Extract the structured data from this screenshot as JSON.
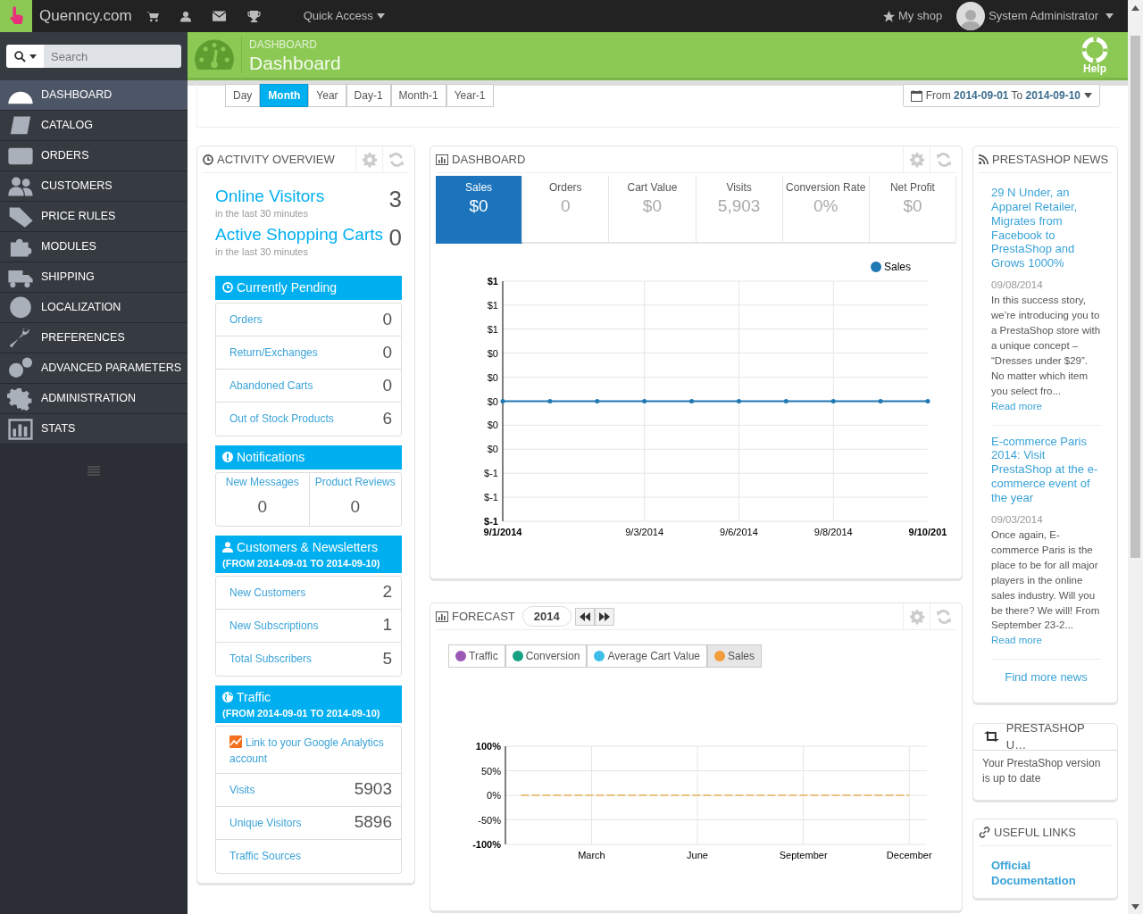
{
  "topbar": {
    "brand": "Quenncy.com",
    "quick_access": "Quick Access",
    "my_shop": "My shop",
    "user": "System Administrator"
  },
  "sidebar": {
    "search_placeholder": "Search",
    "items": [
      {
        "label": "DASHBOARD",
        "selected": true
      },
      {
        "label": "CATALOG",
        "selected": false
      },
      {
        "label": "ORDERS",
        "selected": false
      },
      {
        "label": "CUSTOMERS",
        "selected": false
      },
      {
        "label": "PRICE RULES",
        "selected": false
      },
      {
        "label": "MODULES",
        "selected": false
      },
      {
        "label": "SHIPPING",
        "selected": false
      },
      {
        "label": "LOCALIZATION",
        "selected": false
      },
      {
        "label": "PREFERENCES",
        "selected": false
      },
      {
        "label": "ADVANCED PARAMETERS",
        "selected": false
      },
      {
        "label": "ADMINISTRATION",
        "selected": false
      },
      {
        "label": "STATS",
        "selected": false
      }
    ]
  },
  "page_header": {
    "breadcrumb": "DASHBOARD",
    "title": "Dashboard",
    "help": "Help"
  },
  "period_buttons": [
    {
      "label": "Day",
      "selected": false
    },
    {
      "label": "Month",
      "selected": true
    },
    {
      "label": "Year",
      "selected": false
    },
    {
      "label": "Day-1",
      "selected": false
    },
    {
      "label": "Month-1",
      "selected": false
    },
    {
      "label": "Year-1",
      "selected": false
    }
  ],
  "date_range": {
    "from_label": "From",
    "from": "2014-09-01",
    "to_label": "To",
    "to": "2014-09-10"
  },
  "activity_overview": {
    "title": "ACTIVITY OVERVIEW",
    "stats": [
      {
        "label": "Online Visitors",
        "sublabel": "in the last 30 minutes",
        "value": "3"
      },
      {
        "label": "Active Shopping Carts",
        "sublabel": "in the last 30 minutes",
        "value": "0"
      }
    ],
    "sections": [
      {
        "kind": "list",
        "title": "Currently Pending",
        "rows": [
          {
            "label": "Orders",
            "value": "0"
          },
          {
            "label": "Return/Exchanges",
            "value": "0"
          },
          {
            "label": "Abandoned Carts",
            "value": "0"
          },
          {
            "label": "Out of Stock Products",
            "value": "6"
          }
        ]
      },
      {
        "kind": "grid",
        "title": "Notifications",
        "rows": [
          {
            "label": "New Messages",
            "value": "0"
          },
          {
            "label": "Product Reviews",
            "value": "0"
          }
        ]
      },
      {
        "kind": "list",
        "title": "Customers & Newsletters",
        "subtitle": "(FROM 2014-09-01 TO 2014-09-10)",
        "rows": [
          {
            "label": "New Customers",
            "value": "2"
          },
          {
            "label": "New Subscriptions",
            "value": "1"
          },
          {
            "label": "Total Subscribers",
            "value": "5"
          }
        ]
      },
      {
        "kind": "list",
        "title": "Traffic",
        "subtitle": "(FROM 2014-09-01 TO 2014-09-10)",
        "link": "Link to your Google Analytics account",
        "rows": [
          {
            "label": "Visits",
            "value": "5903"
          },
          {
            "label": "Unique Visitors",
            "value": "5896"
          },
          {
            "label": "Traffic Sources"
          }
        ]
      }
    ]
  },
  "dashboard": {
    "title": "DASHBOARD",
    "kpis": [
      {
        "label": "Sales",
        "value": "$0",
        "selected": true
      },
      {
        "label": "Orders",
        "value": "0",
        "selected": false
      },
      {
        "label": "Cart Value",
        "value": "$0",
        "selected": false
      },
      {
        "label": "Visits",
        "value": "5,903",
        "selected": false
      },
      {
        "label": "Conversion Rate",
        "value": "0%",
        "selected": false
      },
      {
        "label": "Net Profit",
        "value": "$0",
        "selected": false
      }
    ],
    "chart_data": {
      "type": "line",
      "categories": [
        "9/1/2014",
        null,
        null,
        "9/3/2014",
        null,
        "9/6/2014",
        null,
        "9/8/2014",
        null,
        "9/10/201"
      ],
      "grid": true,
      "series": [
        {
          "name": "Sales",
          "color": "#1f77b4",
          "values": [
            0,
            0,
            0,
            0,
            0,
            0,
            0,
            0,
            0,
            0
          ]
        }
      ],
      "ylim": [
        -1,
        1
      ],
      "yticks": [
        {
          "value": 1,
          "label": "$1"
        },
        {
          "value": 0.8,
          "label": "$1"
        },
        {
          "value": 0.6,
          "label": "$1"
        },
        {
          "value": 0.4,
          "label": "$0"
        },
        {
          "value": 0.2,
          "label": "$0"
        },
        {
          "value": 0,
          "label": "$0"
        },
        {
          "value": -0.2,
          "label": "$0"
        },
        {
          "value": -0.4,
          "label": "$0"
        },
        {
          "value": -0.6,
          "label": "$-1"
        },
        {
          "value": -0.8,
          "label": "$-1"
        },
        {
          "value": -1,
          "label": "$-1"
        }
      ]
    }
  },
  "forecast": {
    "title": "FORECAST",
    "year": "2014",
    "toggles": [
      {
        "label": "Traffic",
        "color": "#9b59b6",
        "selected": false
      },
      {
        "label": "Conversion",
        "color": "#16a085",
        "selected": false
      },
      {
        "label": "Average Cart Value",
        "color": "#3ebde8",
        "selected": false
      },
      {
        "label": "Sales",
        "color": "#f39c3c",
        "selected": true
      }
    ],
    "chart_data": {
      "type": "line",
      "categories": [
        null,
        null,
        "March",
        null,
        null,
        "June",
        null,
        null,
        "September",
        null,
        null,
        "December"
      ],
      "grid": true,
      "series": [
        {
          "color": "#e8b25a",
          "line_style": "dashed",
          "values": [
            0,
            0,
            0,
            0,
            0,
            0,
            0,
            0,
            0,
            0,
            0,
            0
          ]
        }
      ],
      "ylim": [
        -1,
        1
      ],
      "yticks": [
        {
          "value": 1,
          "label": "100%"
        },
        {
          "value": 0.5,
          "label": "50%"
        },
        {
          "value": 0,
          "label": "0%"
        },
        {
          "value": -0.5,
          "label": "-50%"
        },
        {
          "value": -1,
          "label": "-100%"
        }
      ]
    }
  },
  "news": {
    "title": "PRESTASHOP NEWS",
    "items": [
      {
        "headline": "29 N Under, an Apparel Retailer, Migrates from Facebook to PrestaShop and Grows 1000%",
        "date": "09/08/2014",
        "body": "In this success story, we’re introducing you to a PrestaShop store with a unique concept – “Dresses under $29”. No matter which item you select fro...",
        "read_more": "Read more"
      },
      {
        "headline": "E-commerce Paris 2014: Visit PrestaShop at the e-commerce event of the year",
        "date": "09/03/2014",
        "body": "Once again, E-commerce Paris is the place to be for all major players in the online sales industry. Will you be there? We will! From September 23-2...",
        "read_more": "Read more"
      }
    ],
    "more": "Find more news"
  },
  "update": {
    "title": "PRESTASHOP U…",
    "text": "Your PrestaShop version is up to date"
  },
  "useful_links": {
    "title": "USEFUL LINKS",
    "links": [
      "Official Documentation"
    ]
  }
}
